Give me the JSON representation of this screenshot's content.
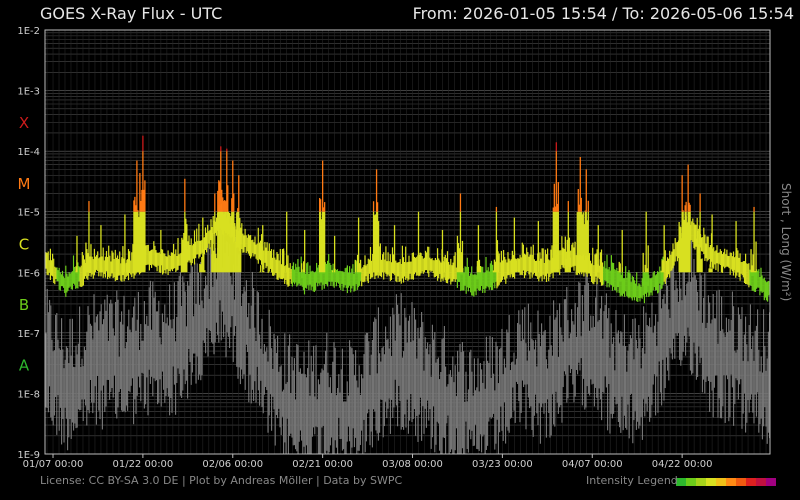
{
  "header": {
    "title": "GOES X-Ray Flux - UTC",
    "range_text": "From: 2026-01-05 15:54  /  To: 2026-05-06 15:54"
  },
  "footer": {
    "license": "License: CC BY-SA 3.0 DE | Plot by Andreas Möller | Data by SWPC",
    "legend_label": "Intensity Legend"
  },
  "colors": {
    "background": "#000000",
    "grid": "#4a4a4a",
    "short_channel": "#7a7a7a",
    "class_A": "#2db82d",
    "class_B": "#6ccc1a",
    "class_C": "#d8e020",
    "class_M": "#ff7a14",
    "class_X": "#cc1b1b",
    "legend_ramp": [
      "#2db82d",
      "#6ccc1a",
      "#a6d31a",
      "#d8e020",
      "#f0c018",
      "#ff8a14",
      "#f05a10",
      "#dd2020",
      "#c01040",
      "#a00080"
    ]
  },
  "chart_data": {
    "type": "line",
    "xlabel": "",
    "ylabel": "Short , Long (W/m²)",
    "yscale": "log",
    "ylim": [
      1e-09,
      0.01
    ],
    "xlim": [
      "2026-01-05",
      "2026-05-06"
    ],
    "grid": true,
    "y_ticks": [
      "1E-9",
      "1E-8",
      "1E-7",
      "1E-6",
      "1E-5",
      "1E-4",
      "1E-3",
      "1E-2"
    ],
    "flare_classes": [
      "X",
      "M",
      "C",
      "B",
      "A"
    ],
    "x_ticks": [
      {
        "label": "01/07 00:00",
        "date": "2026-01-07"
      },
      {
        "label": "01/22 00:00",
        "date": "2026-01-22"
      },
      {
        "label": "02/06 00:00",
        "date": "2026-02-06"
      },
      {
        "label": "02/21 00:00",
        "date": "2026-02-21"
      },
      {
        "label": "03/08 00:00",
        "date": "2026-03-08"
      },
      {
        "label": "03/23 00:00",
        "date": "2026-03-23"
      },
      {
        "label": "04/07 00:00",
        "date": "2026-04-07"
      },
      {
        "label": "04/22 00:00",
        "date": "2026-04-22"
      }
    ],
    "series": [
      {
        "name": "Long",
        "x": [
          "2026-01-05",
          "2026-01-09",
          "2026-01-14",
          "2026-01-19",
          "2026-01-23",
          "2026-01-27",
          "2026-02-01",
          "2026-02-04",
          "2026-02-06",
          "2026-02-10",
          "2026-02-14",
          "2026-02-18",
          "2026-02-22",
          "2026-02-26",
          "2026-03-02",
          "2026-03-06",
          "2026-03-10",
          "2026-03-14",
          "2026-03-18",
          "2026-03-22",
          "2026-03-26",
          "2026-03-30",
          "2026-04-03",
          "2026-04-07",
          "2026-04-11",
          "2026-04-15",
          "2026-04-19",
          "2026-04-23",
          "2026-04-27",
          "2026-05-01",
          "2026-05-06"
        ],
        "y": [
          2e-06,
          7e-07,
          1.5e-06,
          1.2e-06,
          2e-06,
          1.5e-06,
          3e-06,
          8e-06,
          5e-06,
          2.5e-06,
          1.2e-06,
          8e-07,
          1e-06,
          8e-07,
          1.5e-06,
          1.2e-06,
          1.5e-06,
          1.2e-06,
          7e-07,
          1e-06,
          1.5e-06,
          1.2e-06,
          2e-06,
          1.2e-06,
          8e-07,
          5e-07,
          1e-06,
          6e-06,
          2e-06,
          1.5e-06,
          6e-07
        ]
      },
      {
        "name": "Short",
        "x": [
          "2026-01-05",
          "2026-01-09",
          "2026-01-14",
          "2026-01-19",
          "2026-01-23",
          "2026-01-27",
          "2026-02-01",
          "2026-02-04",
          "2026-02-06",
          "2026-02-10",
          "2026-02-14",
          "2026-02-18",
          "2026-02-22",
          "2026-02-26",
          "2026-03-02",
          "2026-03-06",
          "2026-03-10",
          "2026-03-14",
          "2026-03-18",
          "2026-03-22",
          "2026-03-26",
          "2026-03-30",
          "2026-04-03",
          "2026-04-07",
          "2026-04-11",
          "2026-04-15",
          "2026-04-19",
          "2026-04-23",
          "2026-04-27",
          "2026-05-01",
          "2026-05-06"
        ],
        "y": [
          3e-08,
          8e-09,
          2e-08,
          2e-08,
          3e-08,
          3e-08,
          1e-07,
          4e-07,
          2e-07,
          3e-08,
          5e-09,
          3e-09,
          5e-09,
          3e-09,
          1e-08,
          2e-08,
          1e-08,
          5e-09,
          3e-09,
          5e-09,
          2e-08,
          1e-08,
          3e-08,
          5e-08,
          1e-08,
          1e-08,
          5e-08,
          2e-07,
          3e-08,
          2e-08,
          1e-08
        ]
      }
    ],
    "flares": [
      {
        "date": "2026-01-11",
        "peak": 4e-06
      },
      {
        "date": "2026-01-13",
        "peak": 1.5e-05
      },
      {
        "date": "2026-01-15",
        "peak": 6e-06
      },
      {
        "date": "2026-01-19",
        "peak": 9e-06
      },
      {
        "date": "2026-01-21",
        "peak": 7e-05
      },
      {
        "date": "2026-01-22",
        "peak": 0.00018
      },
      {
        "date": "2026-01-25",
        "peak": 5e-06
      },
      {
        "date": "2026-01-29",
        "peak": 3.5e-05
      },
      {
        "date": "2026-02-01",
        "peak": 8e-06
      },
      {
        "date": "2026-02-03",
        "peak": 2e-05
      },
      {
        "date": "2026-02-04",
        "peak": 0.00012
      },
      {
        "date": "2026-02-05",
        "peak": 0.00011
      },
      {
        "date": "2026-02-06",
        "peak": 7e-05
      },
      {
        "date": "2026-02-07",
        "peak": 4e-05
      },
      {
        "date": "2026-02-11",
        "peak": 6e-06
      },
      {
        "date": "2026-02-15",
        "peak": 1e-05
      },
      {
        "date": "2026-02-18",
        "peak": 5e-06
      },
      {
        "date": "2026-02-21",
        "peak": 7e-05
      },
      {
        "date": "2026-02-23",
        "peak": 4e-06
      },
      {
        "date": "2026-02-27",
        "peak": 8e-06
      },
      {
        "date": "2026-03-02",
        "peak": 5e-05
      },
      {
        "date": "2026-03-05",
        "peak": 6e-06
      },
      {
        "date": "2026-03-09",
        "peak": 1e-05
      },
      {
        "date": "2026-03-13",
        "peak": 5e-06
      },
      {
        "date": "2026-03-16",
        "peak": 2e-05
      },
      {
        "date": "2026-03-19",
        "peak": 6e-06
      },
      {
        "date": "2026-03-22",
        "peak": 1.2e-05
      },
      {
        "date": "2026-03-25",
        "peak": 8e-06
      },
      {
        "date": "2026-03-29",
        "peak": 7e-06
      },
      {
        "date": "2026-04-01",
        "peak": 0.00014
      },
      {
        "date": "2026-04-03",
        "peak": 1.5e-05
      },
      {
        "date": "2026-04-05",
        "peak": 8e-05
      },
      {
        "date": "2026-04-06",
        "peak": 5e-05
      },
      {
        "date": "2026-04-08",
        "peak": 6e-06
      },
      {
        "date": "2026-04-12",
        "peak": 5e-06
      },
      {
        "date": "2026-04-16",
        "peak": 1e-05
      },
      {
        "date": "2026-04-19",
        "peak": 6e-06
      },
      {
        "date": "2026-04-22",
        "peak": 4e-05
      },
      {
        "date": "2026-04-23",
        "peak": 6e-05
      },
      {
        "date": "2026-04-25",
        "peak": 2e-05
      },
      {
        "date": "2026-04-27",
        "peak": 9e-06
      },
      {
        "date": "2026-05-01",
        "peak": 7e-06
      },
      {
        "date": "2026-05-04",
        "peak": 1.2e-05
      }
    ]
  }
}
